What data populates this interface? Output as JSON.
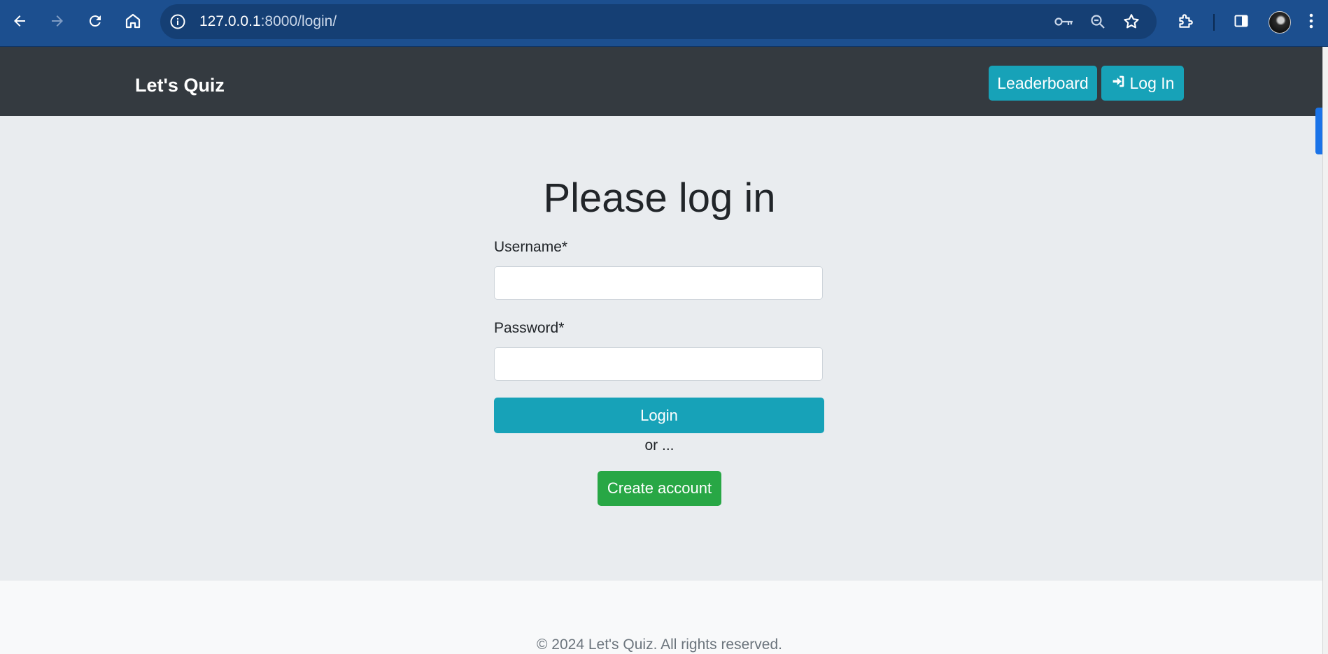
{
  "browser": {
    "url_host": "127.0.0.1",
    "url_rest": ":8000/login/",
    "icons": [
      "back-icon",
      "forward-icon",
      "reload-icon",
      "home-icon",
      "site-info-icon",
      "key-icon",
      "zoom-icon",
      "bookmark-star-icon",
      "extensions-icon",
      "side-panel-icon",
      "profile-avatar",
      "menu-kebab-icon"
    ]
  },
  "navbar": {
    "brand": "Let's Quiz",
    "leaderboard_label": "Leaderboard",
    "login_label": "Log In"
  },
  "form": {
    "title": "Please log in",
    "username_label": "Username*",
    "username_value": "",
    "password_label": "Password*",
    "password_value": "",
    "submit_label": "Login",
    "or_text": "or ...",
    "create_label": "Create account"
  },
  "footer": {
    "copyright": "© 2024 Let's Quiz.  All rights reserved."
  },
  "colors": {
    "chrome": "#1c4f8f",
    "navbar": "#343a40",
    "main_bg": "#e9ecef",
    "info": "#17a2b8",
    "success": "#28a745",
    "footer_bg": "#f8f9fa"
  }
}
